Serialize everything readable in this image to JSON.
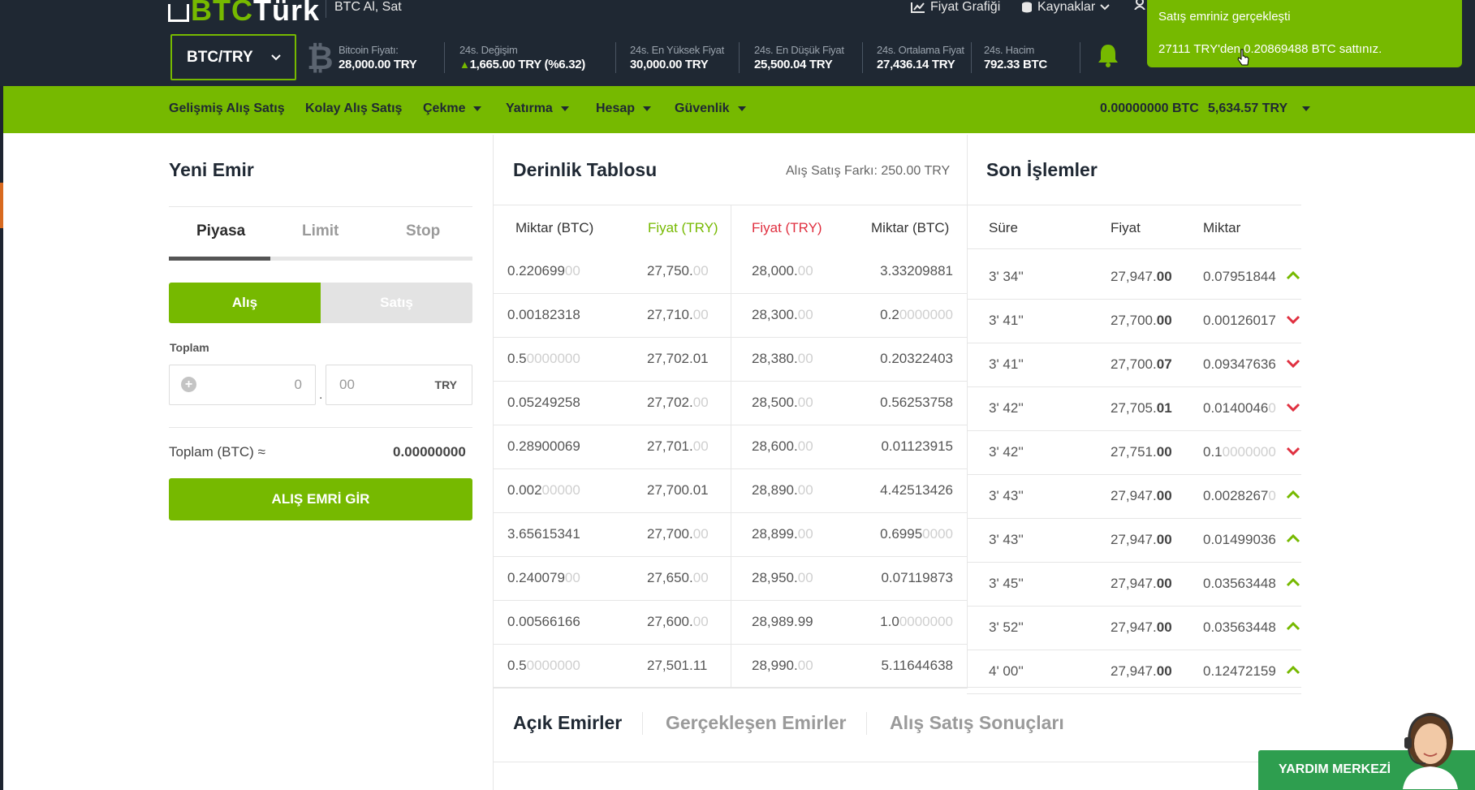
{
  "header": {
    "logo_a": "BTC",
    "logo_b": "Türk",
    "subtitle": "BTC Al, Sat",
    "nav": [
      {
        "label": "Fiyat Grafiği"
      },
      {
        "label": "Kaynaklar"
      }
    ]
  },
  "ticker": {
    "pair": "BTC/TRY",
    "stats": [
      {
        "label": "Bitcoin Fiyatı:",
        "value": "28,000.00 TRY"
      },
      {
        "label": "24s. Değişim",
        "value": "1,665.00 TRY (%6.32)"
      },
      {
        "label": "24s. En Yüksek Fiyat",
        "value": "30,000.00 TRY"
      },
      {
        "label": "24s. En Düşük Fiyat",
        "value": "25,500.04 TRY"
      },
      {
        "label": "24s. Ortalama Fiyat",
        "value": "27,436.14 TRY"
      },
      {
        "label": "24s. Hacim",
        "value": "792.33 BTC"
      }
    ]
  },
  "toast": {
    "line1": "Satış emriniz gerçekleşti",
    "line2": "27111 TRY'den 0.20869488 BTC sattınız."
  },
  "menu": {
    "items": [
      "Gelişmiş Alış Satış",
      "Kolay Alış Satış",
      "Çekme",
      "Yatırma",
      "Hesap",
      "Güvenlik"
    ],
    "btc_balance": "0.00000000 BTC",
    "try_balance": "5,634.57 TRY"
  },
  "order": {
    "title": "Yeni Emir",
    "tabs": [
      "Piyasa",
      "Limit",
      "Stop"
    ],
    "buy_label": "Alış",
    "sell_label": "Satış",
    "total_label": "Toplam",
    "int_placeholder": "0",
    "dec_placeholder": "00",
    "currency": "TRY",
    "total_btc_label": "Toplam (BTC) ≈",
    "total_btc_value": "0.00000000",
    "submit_label": "ALIŞ EMRİ GİR"
  },
  "depth": {
    "title": "Derinlik Tablosu",
    "spread": "Alış Satış Farkı: 250.00 TRY",
    "headers": [
      "Miktar (BTC)",
      "Fiyat (TRY)",
      "Fiyat (TRY)",
      "Miktar (BTC)"
    ],
    "rows": [
      [
        [
          "0.220699",
          "00"
        ],
        [
          "27,750.",
          "00"
        ],
        [
          "28,000.",
          "00"
        ],
        [
          "3.33209881",
          ""
        ]
      ],
      [
        [
          "0.00182318",
          ""
        ],
        [
          "27,710.",
          "00"
        ],
        [
          "28,300.",
          "00"
        ],
        [
          "0.2",
          "0000000"
        ]
      ],
      [
        [
          "0.5",
          "0000000"
        ],
        [
          "27,702.01",
          ""
        ],
        [
          "28,380.",
          "00"
        ],
        [
          "0.20322403",
          ""
        ]
      ],
      [
        [
          "0.05249258",
          ""
        ],
        [
          "27,702.",
          "00"
        ],
        [
          "28,500.",
          "00"
        ],
        [
          "0.56253758",
          ""
        ]
      ],
      [
        [
          "0.28900069",
          ""
        ],
        [
          "27,701.",
          "00"
        ],
        [
          "28,600.",
          "00"
        ],
        [
          "0.01123915",
          ""
        ]
      ],
      [
        [
          "0.002",
          "00000"
        ],
        [
          "27,700.01",
          ""
        ],
        [
          "28,890.",
          "00"
        ],
        [
          "4.42513426",
          ""
        ]
      ],
      [
        [
          "3.65615341",
          ""
        ],
        [
          "27,700.",
          "00"
        ],
        [
          "28,899.",
          "00"
        ],
        [
          "0.6995",
          "0000"
        ]
      ],
      [
        [
          "0.240079",
          "00"
        ],
        [
          "27,650.",
          "00"
        ],
        [
          "28,950.",
          "00"
        ],
        [
          "0.07119873",
          ""
        ]
      ],
      [
        [
          "0.00566166",
          ""
        ],
        [
          "27,600.",
          "00"
        ],
        [
          "28,989.99",
          ""
        ],
        [
          "1.0",
          "0000000"
        ]
      ],
      [
        [
          "0.5",
          "0000000"
        ],
        [
          "27,501.11",
          ""
        ],
        [
          "28,990.",
          "00"
        ],
        [
          "5.11644638",
          ""
        ]
      ]
    ]
  },
  "trades": {
    "title": "Son İşlemler",
    "headers": [
      "Süre",
      "Fiyat",
      "Miktar"
    ],
    "rows": [
      {
        "time": "3' 34''",
        "price_a": "27,947.",
        "price_b": "00",
        "amt_a": "0.07951844",
        "amt_b": "",
        "dir": "up"
      },
      {
        "time": "3' 41''",
        "price_a": "27,700.",
        "price_b": "00",
        "amt_a": "0.00126017",
        "amt_b": "",
        "dir": "down"
      },
      {
        "time": "3' 41''",
        "price_a": "27,700.",
        "price_b": "07",
        "amt_a": "0.09347636",
        "amt_b": "",
        "dir": "down"
      },
      {
        "time": "3' 42''",
        "price_a": "27,705.",
        "price_b": "01",
        "amt_a": "0.0140046",
        "amt_b": "0",
        "dir": "down"
      },
      {
        "time": "3' 42''",
        "price_a": "27,751.",
        "price_b": "00",
        "amt_a": "0.1",
        "amt_b": "0000000",
        "dir": "down"
      },
      {
        "time": "3' 43''",
        "price_a": "27,947.",
        "price_b": "00",
        "amt_a": "0.0028267",
        "amt_b": "0",
        "dir": "up"
      },
      {
        "time": "3' 43''",
        "price_a": "27,947.",
        "price_b": "00",
        "amt_a": "0.01499036",
        "amt_b": "",
        "dir": "up"
      },
      {
        "time": "3' 45''",
        "price_a": "27,947.",
        "price_b": "00",
        "amt_a": "0.03563448",
        "amt_b": "",
        "dir": "up"
      },
      {
        "time": "3' 52''",
        "price_a": "27,947.",
        "price_b": "00",
        "amt_a": "0.03563448",
        "amt_b": "",
        "dir": "up"
      },
      {
        "time": "4' 00''",
        "price_a": "27,947.",
        "price_b": "00",
        "amt_a": "0.12472159",
        "amt_b": "",
        "dir": "up"
      }
    ]
  },
  "bottom_tabs": [
    "Açık Emirler",
    "Gerçekleşen Emirler",
    "Alış Satış Sonuçları"
  ],
  "help": {
    "label": "YARDIM MERKEZİ"
  },
  "colors": {
    "brand_green": "#76b900",
    "dark": "#1f2833",
    "sell_red": "#e03040"
  }
}
